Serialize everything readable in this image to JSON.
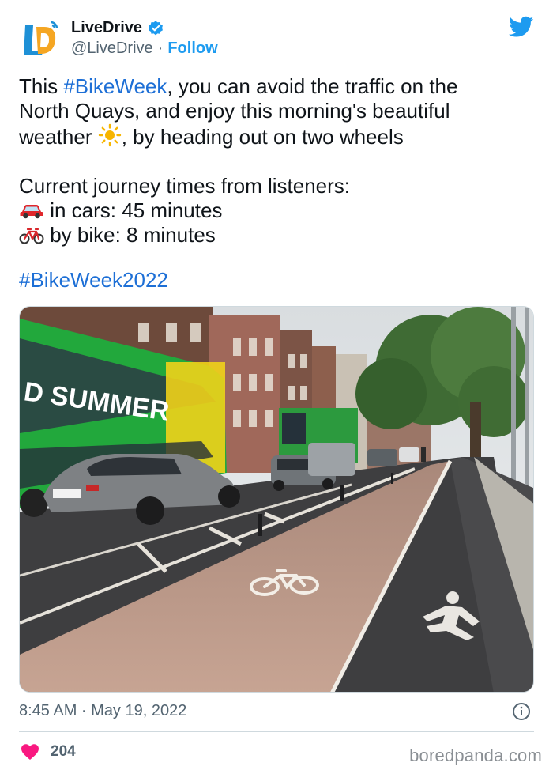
{
  "account": {
    "display_name": "LiveDrive",
    "handle": "@LiveDrive",
    "separator": "·",
    "follow_label": "Follow"
  },
  "tweet": {
    "line1_pre": "This ",
    "line1_hashtag": "#BikeWeek",
    "line1_post": ", you can avoid the traffic on the",
    "line2": "North Quays, and enjoy this morning's beautiful",
    "line3_pre": "weather ",
    "line3_post": ", by heading out on two wheels",
    "line4": "Current journey times from listeners:",
    "line5": " in cars: 45 minutes",
    "line6": " by bike: 8 minutes",
    "hashtag_footer": "#BikeWeek2022"
  },
  "image_sign_text": "D SUMMER",
  "footer": {
    "timestamp": "8:45 AM · May 19, 2022",
    "likes_count": "204",
    "watermark": "boredpanda.com"
  },
  "colors": {
    "link": "#1d6fd6",
    "secondary_text": "#536471",
    "heart": "#f91880",
    "twitter_blue": "#1d9bf0"
  }
}
